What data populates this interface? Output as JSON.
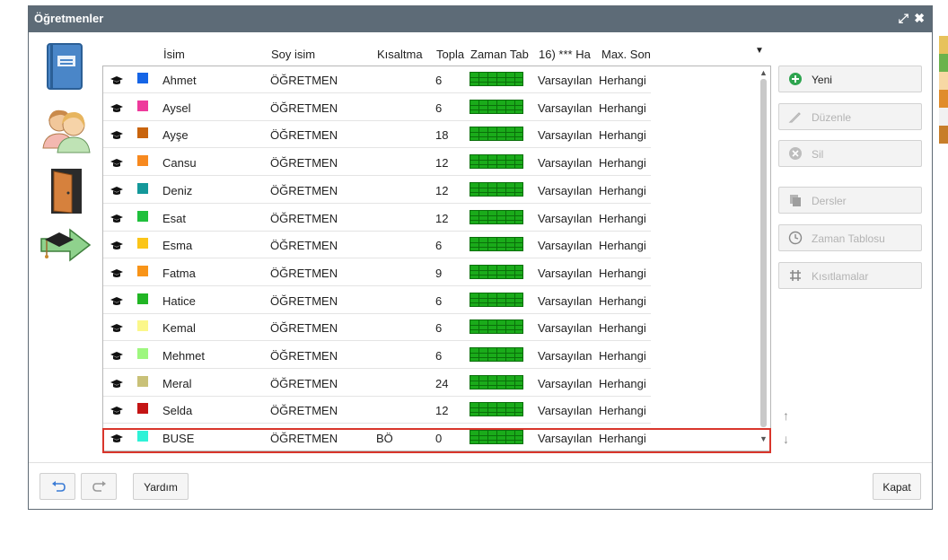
{
  "window": {
    "title": "Öğretmenler"
  },
  "columns": {
    "isim": "İsim",
    "soyisim": "Soy isim",
    "kisaltma": "Kısaltma",
    "toplam": "Topla",
    "zaman": "Zaman Tab",
    "h16": "16) *** Ha",
    "max": "Max. Son"
  },
  "rows": [
    {
      "isim": "Ahmet",
      "soyisim": "ÖĞRETMEN",
      "kisaltma": "",
      "toplam": "6",
      "h16": "Varsayılan",
      "max": "Herhangi",
      "color": "#1565e6"
    },
    {
      "isim": "Aysel",
      "soyisim": "ÖĞRETMEN",
      "kisaltma": "",
      "toplam": "6",
      "h16": "Varsayılan",
      "max": "Herhangi",
      "color": "#ee3a9c"
    },
    {
      "isim": "Ayşe",
      "soyisim": "ÖĞRETMEN",
      "kisaltma": "",
      "toplam": "18",
      "h16": "Varsayılan",
      "max": "Herhangi",
      "color": "#c9640d"
    },
    {
      "isim": "Cansu",
      "soyisim": "ÖĞRETMEN",
      "kisaltma": "",
      "toplam": "12",
      "h16": "Varsayılan",
      "max": "Herhangi",
      "color": "#f7891f"
    },
    {
      "isim": "Deniz",
      "soyisim": "ÖĞRETMEN",
      "kisaltma": "",
      "toplam": "12",
      "h16": "Varsayılan",
      "max": "Herhangi",
      "color": "#14989a"
    },
    {
      "isim": "Esat",
      "soyisim": "ÖĞRETMEN",
      "kisaltma": "",
      "toplam": "12",
      "h16": "Varsayılan",
      "max": "Herhangi",
      "color": "#1fc03c"
    },
    {
      "isim": "Esma",
      "soyisim": "ÖĞRETMEN",
      "kisaltma": "",
      "toplam": "6",
      "h16": "Varsayılan",
      "max": "Herhangi",
      "color": "#fbc519"
    },
    {
      "isim": "Fatma",
      "soyisim": "ÖĞRETMEN",
      "kisaltma": "",
      "toplam": "9",
      "h16": "Varsayılan",
      "max": "Herhangi",
      "color": "#f89418"
    },
    {
      "isim": "Hatice",
      "soyisim": "ÖĞRETMEN",
      "kisaltma": "",
      "toplam": "6",
      "h16": "Varsayılan",
      "max": "Herhangi",
      "color": "#21b524"
    },
    {
      "isim": "Kemal",
      "soyisim": "ÖĞRETMEN",
      "kisaltma": "",
      "toplam": "6",
      "h16": "Varsayılan",
      "max": "Herhangi",
      "color": "#fbf78a"
    },
    {
      "isim": "Mehmet",
      "soyisim": "ÖĞRETMEN",
      "kisaltma": "",
      "toplam": "6",
      "h16": "Varsayılan",
      "max": "Herhangi",
      "color": "#9ef77f"
    },
    {
      "isim": "Meral",
      "soyisim": "ÖĞRETMEN",
      "kisaltma": "",
      "toplam": "24",
      "h16": "Varsayılan",
      "max": "Herhangi",
      "color": "#c9c178"
    },
    {
      "isim": "Selda",
      "soyisim": "ÖĞRETMEN",
      "kisaltma": "",
      "toplam": "12",
      "h16": "Varsayılan",
      "max": "Herhangi",
      "color": "#c41414"
    },
    {
      "isim": "BUSE",
      "soyisim": "ÖĞRETMEN",
      "kisaltma": "BÖ",
      "toplam": "0",
      "h16": "Varsayılan",
      "max": "Herhangi",
      "color": "#2ef2d7"
    }
  ],
  "actions": {
    "yeni": "Yeni",
    "duzenle": "Düzenle",
    "sil": "Sil",
    "dersler": "Dersler",
    "zaman_tablosu": "Zaman Tablosu",
    "kisitlamalar": "Kısıtlamalar"
  },
  "footer": {
    "yardim": "Yardım",
    "kapat": "Kapat"
  },
  "icons": {
    "sidebar": [
      "book-icon",
      "teachers-icon",
      "door-icon",
      "graduation-arrow-icon"
    ]
  },
  "colors": {
    "titlebar": "#5d6b77",
    "selection_outline": "#d9362c",
    "timetable_green": "#1aab1a",
    "add_green": "#2ea44f"
  }
}
